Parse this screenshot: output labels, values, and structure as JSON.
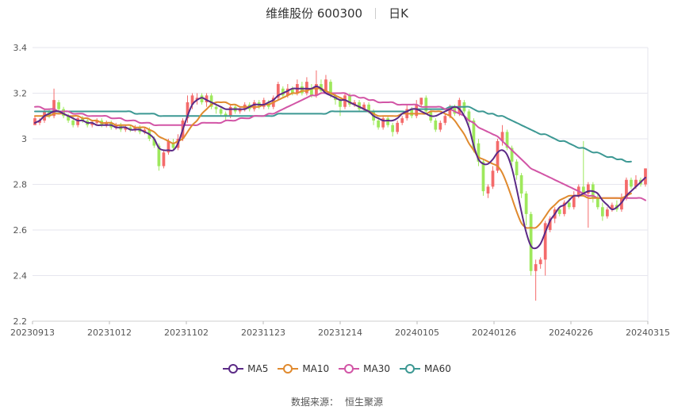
{
  "title": {
    "stock": "维维股份 600300",
    "period": "日K"
  },
  "source": {
    "label": "数据来源：",
    "name": "恒生聚源"
  },
  "chart_data": {
    "type": "candlestick",
    "ylim": [
      2.2,
      3.4
    ],
    "yticks": [
      "2.2",
      "2.4",
      "2.6",
      "2.8",
      "3",
      "3.2",
      "3.4"
    ],
    "xticks": [
      "20230913",
      "20231012",
      "20231102",
      "20231123",
      "20231214",
      "20240105",
      "20240126",
      "20240226",
      "20240315"
    ],
    "grid": true,
    "up_color": "#f46b6b",
    "down_color": "#9ee85c",
    "legend": [
      {
        "name": "MA5",
        "color": "#5b2a86"
      },
      {
        "name": "MA10",
        "color": "#e08a2e"
      },
      {
        "name": "MA30",
        "color": "#d255a6"
      },
      {
        "name": "MA60",
        "color": "#3c9893"
      }
    ],
    "candles": [
      [
        3.06,
        3.09,
        3.06,
        3.1
      ],
      [
        3.07,
        3.08,
        3.06,
        3.09
      ],
      [
        3.08,
        3.12,
        3.07,
        3.13
      ],
      [
        3.12,
        3.1,
        3.09,
        3.13
      ],
      [
        3.1,
        3.17,
        3.09,
        3.22
      ],
      [
        3.16,
        3.13,
        3.11,
        3.17
      ],
      [
        3.13,
        3.1,
        3.09,
        3.14
      ],
      [
        3.1,
        3.08,
        3.07,
        3.11
      ],
      [
        3.08,
        3.06,
        3.05,
        3.1
      ],
      [
        3.06,
        3.09,
        3.05,
        3.1
      ],
      [
        3.09,
        3.08,
        3.07,
        3.1
      ],
      [
        3.08,
        3.06,
        3.05,
        3.09
      ],
      [
        3.06,
        3.07,
        3.05,
        3.08
      ],
      [
        3.07,
        3.08,
        3.06,
        3.09
      ],
      [
        3.08,
        3.06,
        3.05,
        3.09
      ],
      [
        3.06,
        3.07,
        3.05,
        3.08
      ],
      [
        3.07,
        3.05,
        3.04,
        3.08
      ],
      [
        3.05,
        3.06,
        3.04,
        3.07
      ],
      [
        3.06,
        3.04,
        3.03,
        3.07
      ],
      [
        3.04,
        3.05,
        3.03,
        3.06
      ],
      [
        3.05,
        3.04,
        3.03,
        3.06
      ],
      [
        3.04,
        3.05,
        3.03,
        3.06
      ],
      [
        3.05,
        3.03,
        3.02,
        3.06
      ],
      [
        3.03,
        3.04,
        3.02,
        3.05
      ],
      [
        3.04,
        3.0,
        2.99,
        3.05
      ],
      [
        3.0,
        2.97,
        2.96,
        3.01
      ],
      [
        2.97,
        2.88,
        2.86,
        2.98
      ],
      [
        2.88,
        2.94,
        2.87,
        2.95
      ],
      [
        2.94,
        2.99,
        2.93,
        3.0
      ],
      [
        2.98,
        2.96,
        2.95,
        3.0
      ],
      [
        2.96,
        3.0,
        2.95,
        3.02
      ],
      [
        3.0,
        3.08,
        2.99,
        3.09
      ],
      [
        3.09,
        3.16,
        3.07,
        3.19
      ],
      [
        3.15,
        3.19,
        3.13,
        3.2
      ],
      [
        3.17,
        3.18,
        3.15,
        3.2
      ],
      [
        3.19,
        3.16,
        3.15,
        3.2
      ],
      [
        3.16,
        3.19,
        3.14,
        3.2
      ],
      [
        3.19,
        3.14,
        3.13,
        3.2
      ],
      [
        3.14,
        3.13,
        3.11,
        3.15
      ],
      [
        3.13,
        3.11,
        3.1,
        3.14
      ],
      [
        3.11,
        3.1,
        3.08,
        3.12
      ],
      [
        3.1,
        3.14,
        3.09,
        3.15
      ],
      [
        3.14,
        3.12,
        3.11,
        3.15
      ],
      [
        3.12,
        3.13,
        3.11,
        3.14
      ],
      [
        3.13,
        3.15,
        3.12,
        3.16
      ],
      [
        3.15,
        3.13,
        3.12,
        3.16
      ],
      [
        3.13,
        3.16,
        3.12,
        3.17
      ],
      [
        3.16,
        3.14,
        3.13,
        3.17
      ],
      [
        3.14,
        3.17,
        3.13,
        3.18
      ],
      [
        3.16,
        3.14,
        3.13,
        3.17
      ],
      [
        3.14,
        3.18,
        3.13,
        3.19
      ],
      [
        3.18,
        3.24,
        3.17,
        3.25
      ],
      [
        3.22,
        3.19,
        3.18,
        3.23
      ],
      [
        3.19,
        3.22,
        3.18,
        3.24
      ],
      [
        3.22,
        3.2,
        3.19,
        3.23
      ],
      [
        3.2,
        3.24,
        3.19,
        3.26
      ],
      [
        3.23,
        3.2,
        3.19,
        3.25
      ],
      [
        3.2,
        3.25,
        3.19,
        3.27
      ],
      [
        3.22,
        3.19,
        3.18,
        3.24
      ],
      [
        3.19,
        3.24,
        3.18,
        3.3
      ],
      [
        3.24,
        3.21,
        3.2,
        3.26
      ],
      [
        3.21,
        3.26,
        3.2,
        3.28
      ],
      [
        3.25,
        3.19,
        3.18,
        3.26
      ],
      [
        3.19,
        3.17,
        3.15,
        3.2
      ],
      [
        3.17,
        3.14,
        3.1,
        3.18
      ],
      [
        3.14,
        3.19,
        3.13,
        3.2
      ],
      [
        3.19,
        3.15,
        3.14,
        3.2
      ],
      [
        3.15,
        3.16,
        3.14,
        3.17
      ],
      [
        3.16,
        3.13,
        3.12,
        3.17
      ],
      [
        3.13,
        3.15,
        3.12,
        3.16
      ],
      [
        3.15,
        3.12,
        3.11,
        3.16
      ],
      [
        3.12,
        3.08,
        3.06,
        3.13
      ],
      [
        3.08,
        3.05,
        3.04,
        3.09
      ],
      [
        3.05,
        3.09,
        3.04,
        3.1
      ],
      [
        3.09,
        3.06,
        3.05,
        3.1
      ],
      [
        3.06,
        3.03,
        3.01,
        3.07
      ],
      [
        3.03,
        3.07,
        3.02,
        3.08
      ],
      [
        3.07,
        3.09,
        3.06,
        3.1
      ],
      [
        3.09,
        3.13,
        3.08,
        3.15
      ],
      [
        3.13,
        3.1,
        3.09,
        3.14
      ],
      [
        3.1,
        3.15,
        3.09,
        3.17
      ],
      [
        3.15,
        3.18,
        3.14,
        3.18
      ],
      [
        3.18,
        3.12,
        3.11,
        3.19
      ],
      [
        3.12,
        3.08,
        3.07,
        3.13
      ],
      [
        3.08,
        3.04,
        3.03,
        3.09
      ],
      [
        3.04,
        3.07,
        3.03,
        3.08
      ],
      [
        3.07,
        3.1,
        3.06,
        3.11
      ],
      [
        3.1,
        3.14,
        3.09,
        3.15
      ],
      [
        3.14,
        3.11,
        3.1,
        3.15
      ],
      [
        3.11,
        3.17,
        3.1,
        3.18
      ],
      [
        3.16,
        3.12,
        3.11,
        3.17
      ],
      [
        3.12,
        3.08,
        3.06,
        3.13
      ],
      [
        3.08,
        2.95,
        2.94,
        3.09
      ],
      [
        2.98,
        2.9,
        2.88,
        3.0
      ],
      [
        2.9,
        2.77,
        2.75,
        2.91
      ],
      [
        2.76,
        2.79,
        2.74,
        2.8
      ],
      [
        2.79,
        2.86,
        2.78,
        2.88
      ],
      [
        2.86,
        2.99,
        2.85,
        3.0
      ],
      [
        2.99,
        3.03,
        2.97,
        3.06
      ],
      [
        3.03,
        2.96,
        2.95,
        3.04
      ],
      [
        2.96,
        2.9,
        2.88,
        2.97
      ],
      [
        2.9,
        2.84,
        2.82,
        2.91
      ],
      [
        2.84,
        2.76,
        2.74,
        2.85
      ],
      [
        2.76,
        2.67,
        2.62,
        2.77
      ],
      [
        2.67,
        2.42,
        2.4,
        2.68
      ],
      [
        2.42,
        2.45,
        2.29,
        2.47
      ],
      [
        2.45,
        2.47,
        2.43,
        2.48
      ],
      [
        2.47,
        2.63,
        2.4,
        2.64
      ],
      [
        2.6,
        2.65,
        2.59,
        2.66
      ],
      [
        2.65,
        2.69,
        2.63,
        2.7
      ],
      [
        2.69,
        2.67,
        2.66,
        2.7
      ],
      [
        2.67,
        2.72,
        2.66,
        2.73
      ],
      [
        2.72,
        2.7,
        2.69,
        2.74
      ],
      [
        2.7,
        2.75,
        2.69,
        2.77
      ],
      [
        2.75,
        2.79,
        2.74,
        2.8
      ],
      [
        2.79,
        2.76,
        2.75,
        2.99
      ],
      [
        2.76,
        2.8,
        2.61,
        2.81
      ],
      [
        2.8,
        2.74,
        2.72,
        2.81
      ],
      [
        2.74,
        2.7,
        2.69,
        2.76
      ],
      [
        2.7,
        2.66,
        2.64,
        2.72
      ],
      [
        2.66,
        2.69,
        2.65,
        2.7
      ],
      [
        2.69,
        2.71,
        2.68,
        2.72
      ],
      [
        2.71,
        2.69,
        2.68,
        2.73
      ],
      [
        2.69,
        2.74,
        2.68,
        2.76
      ],
      [
        2.74,
        2.82,
        2.73,
        2.83
      ],
      [
        2.82,
        2.79,
        2.78,
        2.83
      ],
      [
        2.79,
        2.82,
        2.78,
        2.84
      ],
      [
        2.82,
        2.8,
        2.79,
        2.83
      ],
      [
        2.8,
        2.87,
        2.79,
        2.87
      ]
    ],
    "series": [
      {
        "name": "MA5",
        "values": [
          3.07,
          3.08,
          3.1,
          3.11,
          3.12,
          3.12,
          3.11,
          3.1,
          3.09,
          3.08,
          3.08,
          3.07,
          3.07,
          3.06,
          3.06,
          3.06,
          3.06,
          3.05,
          3.05,
          3.05,
          3.04,
          3.04,
          3.04,
          3.03,
          3.02,
          3.0,
          2.96,
          2.95,
          2.95,
          2.95,
          2.98,
          3.04,
          3.1,
          3.15,
          3.17,
          3.18,
          3.17,
          3.16,
          3.15,
          3.14,
          3.13,
          3.13,
          3.13,
          3.13,
          3.13,
          3.14,
          3.15,
          3.15,
          3.15,
          3.16,
          3.17,
          3.19,
          3.2,
          3.21,
          3.22,
          3.22,
          3.22,
          3.22,
          3.22,
          3.23,
          3.22,
          3.2,
          3.19,
          3.18,
          3.17,
          3.17,
          3.16,
          3.15,
          3.14,
          3.13,
          3.12,
          3.1,
          3.09,
          3.08,
          3.08,
          3.08,
          3.09,
          3.11,
          3.12,
          3.13,
          3.13,
          3.12,
          3.11,
          3.1,
          3.1,
          3.11,
          3.12,
          3.13,
          3.14,
          3.13,
          3.1,
          3.05,
          2.97,
          2.91,
          2.89,
          2.89,
          2.91,
          2.94,
          2.95,
          2.93,
          2.87,
          2.78,
          2.68,
          2.59,
          2.53,
          2.52,
          2.54,
          2.59,
          2.64,
          2.67,
          2.7,
          2.71,
          2.73,
          2.75,
          2.75,
          2.76,
          2.77,
          2.77,
          2.76,
          2.73,
          2.71,
          2.69,
          2.7,
          2.72,
          2.75,
          2.77,
          2.79,
          2.81,
          2.83
        ]
      },
      {
        "name": "MA10",
        "values": [
          3.1,
          3.1,
          3.1,
          3.1,
          3.11,
          3.11,
          3.11,
          3.1,
          3.1,
          3.1,
          3.09,
          3.09,
          3.08,
          3.08,
          3.07,
          3.07,
          3.07,
          3.06,
          3.06,
          3.06,
          3.06,
          3.05,
          3.05,
          3.05,
          3.04,
          3.03,
          3.01,
          3.0,
          2.99,
          2.98,
          2.99,
          3.0,
          3.03,
          3.06,
          3.08,
          3.11,
          3.13,
          3.15,
          3.16,
          3.16,
          3.16,
          3.15,
          3.15,
          3.14,
          3.14,
          3.14,
          3.14,
          3.14,
          3.15,
          3.15,
          3.16,
          3.17,
          3.18,
          3.19,
          3.2,
          3.2,
          3.21,
          3.21,
          3.22,
          3.22,
          3.22,
          3.21,
          3.2,
          3.19,
          3.18,
          3.17,
          3.16,
          3.15,
          3.14,
          3.13,
          3.12,
          3.11,
          3.1,
          3.1,
          3.1,
          3.1,
          3.1,
          3.11,
          3.11,
          3.11,
          3.11,
          3.11,
          3.11,
          3.12,
          3.12,
          3.12,
          3.11,
          3.1,
          3.08,
          3.05,
          3.02,
          2.98,
          2.95,
          2.92,
          2.91,
          2.9,
          2.89,
          2.88,
          2.85,
          2.8,
          2.74,
          2.68,
          2.63,
          2.61,
          2.61,
          2.61,
          2.63,
          2.66,
          2.69,
          2.71,
          2.73,
          2.74,
          2.75,
          2.75,
          2.75,
          2.75,
          2.74,
          2.74,
          2.74,
          2.74,
          2.74,
          2.74,
          2.74,
          2.74,
          2.75,
          2.76
        ]
      },
      {
        "name": "MA30",
        "values": [
          3.14,
          3.14,
          3.13,
          3.13,
          3.13,
          3.12,
          3.12,
          3.12,
          3.11,
          3.11,
          3.11,
          3.1,
          3.1,
          3.1,
          3.1,
          3.1,
          3.09,
          3.09,
          3.09,
          3.08,
          3.08,
          3.08,
          3.07,
          3.07,
          3.07,
          3.06,
          3.06,
          3.06,
          3.06,
          3.06,
          3.06,
          3.06,
          3.06,
          3.06,
          3.06,
          3.07,
          3.07,
          3.07,
          3.07,
          3.07,
          3.08,
          3.08,
          3.08,
          3.09,
          3.09,
          3.09,
          3.1,
          3.1,
          3.1,
          3.11,
          3.11,
          3.12,
          3.13,
          3.14,
          3.15,
          3.16,
          3.17,
          3.18,
          3.19,
          3.19,
          3.2,
          3.2,
          3.2,
          3.2,
          3.2,
          3.2,
          3.19,
          3.19,
          3.18,
          3.18,
          3.17,
          3.17,
          3.16,
          3.16,
          3.16,
          3.16,
          3.15,
          3.15,
          3.15,
          3.15,
          3.15,
          3.14,
          3.14,
          3.14,
          3.14,
          3.14,
          3.13,
          3.13,
          3.12,
          3.11,
          3.1,
          3.08,
          3.07,
          3.05,
          3.04,
          3.03,
          3.02,
          3.01,
          2.99,
          2.97,
          2.95,
          2.93,
          2.91,
          2.89,
          2.87,
          2.86,
          2.85,
          2.84,
          2.83,
          2.82,
          2.81,
          2.8,
          2.79,
          2.78,
          2.77,
          2.76,
          2.75,
          2.75,
          2.74,
          2.74,
          2.74,
          2.74,
          2.74,
          2.74,
          2.74,
          2.74,
          2.74,
          2.74,
          2.73
        ]
      },
      {
        "name": "MA60",
        "values": [
          3.12,
          3.12,
          3.12,
          3.12,
          3.12,
          3.12,
          3.12,
          3.12,
          3.12,
          3.12,
          3.12,
          3.12,
          3.12,
          3.12,
          3.12,
          3.12,
          3.12,
          3.12,
          3.12,
          3.12,
          3.12,
          3.11,
          3.11,
          3.11,
          3.11,
          3.11,
          3.1,
          3.1,
          3.1,
          3.1,
          3.1,
          3.1,
          3.1,
          3.1,
          3.1,
          3.1,
          3.1,
          3.1,
          3.1,
          3.1,
          3.1,
          3.1,
          3.1,
          3.1,
          3.1,
          3.1,
          3.1,
          3.1,
          3.1,
          3.1,
          3.1,
          3.11,
          3.11,
          3.11,
          3.11,
          3.11,
          3.11,
          3.11,
          3.11,
          3.11,
          3.11,
          3.11,
          3.12,
          3.12,
          3.12,
          3.12,
          3.12,
          3.12,
          3.12,
          3.12,
          3.12,
          3.12,
          3.12,
          3.12,
          3.12,
          3.12,
          3.12,
          3.12,
          3.12,
          3.13,
          3.13,
          3.13,
          3.13,
          3.13,
          3.13,
          3.13,
          3.13,
          3.14,
          3.14,
          3.14,
          3.14,
          3.14,
          3.13,
          3.12,
          3.12,
          3.11,
          3.11,
          3.1,
          3.1,
          3.09,
          3.08,
          3.07,
          3.06,
          3.05,
          3.04,
          3.03,
          3.02,
          3.02,
          3.01,
          3.0,
          2.99,
          2.99,
          2.98,
          2.97,
          2.96,
          2.96,
          2.95,
          2.94,
          2.94,
          2.93,
          2.92,
          2.92,
          2.91,
          2.91,
          2.9,
          2.9
        ]
      }
    ]
  }
}
